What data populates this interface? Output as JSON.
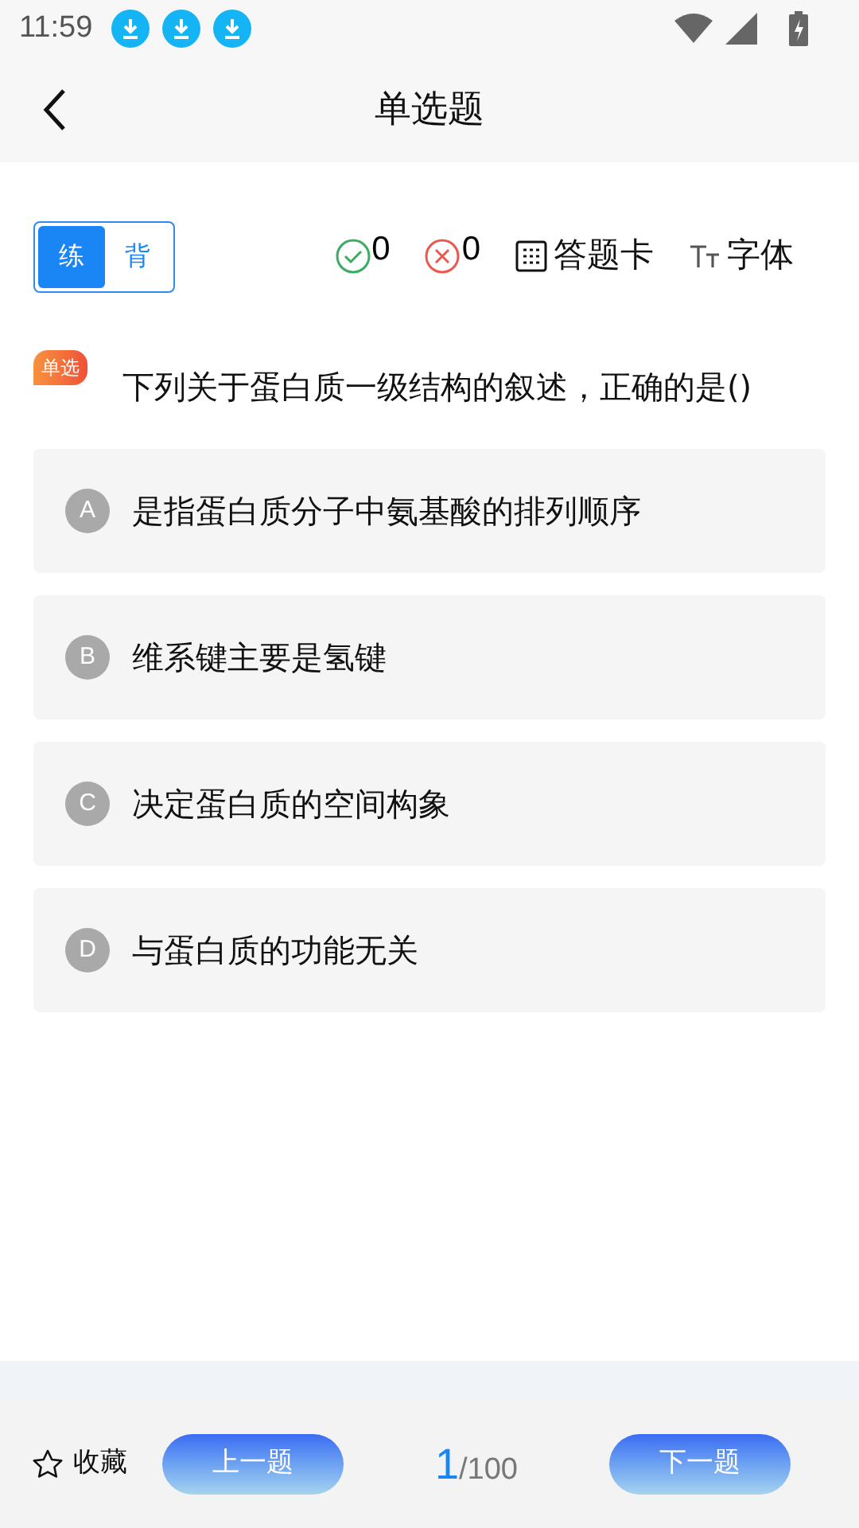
{
  "status_bar": {
    "time": "11:59",
    "notifications": [
      {
        "kind": "download"
      },
      {
        "kind": "download"
      },
      {
        "kind": "download"
      }
    ]
  },
  "nav": {
    "title": "单选题"
  },
  "mode_toggle": [
    {
      "label": "练",
      "selected": true
    },
    {
      "label": "背",
      "selected": false
    }
  ],
  "stats": {
    "correct": "0",
    "wrong": "0"
  },
  "tools": {
    "answer_card": "答题卡",
    "font": "字体"
  },
  "question": {
    "tag": "单选",
    "text": "下列关于蛋白质一级结构的叙述，正确的是()"
  },
  "options": [
    {
      "letter": "A",
      "text": "是指蛋白质分子中氨基酸的排列顺序"
    },
    {
      "letter": "B",
      "text": "维系键主要是氢键"
    },
    {
      "letter": "C",
      "text": "决定蛋白质的空间构象"
    },
    {
      "letter": "D",
      "text": "与蛋白质的功能无关"
    }
  ],
  "bottom_bar": {
    "favorite": "收藏",
    "prev": "上一题",
    "current": "1",
    "total": "/100",
    "next": "下一题"
  }
}
